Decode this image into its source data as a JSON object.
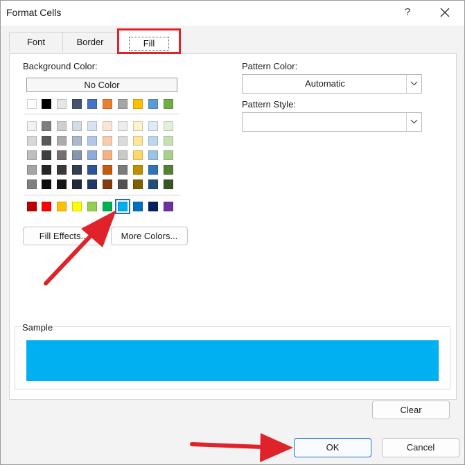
{
  "window": {
    "title": "Format Cells",
    "help_label": "?"
  },
  "tabs": [
    {
      "label": "Font"
    },
    {
      "label": "Border"
    },
    {
      "label": "Fill"
    }
  ],
  "fill": {
    "background_color_label": "Background Color:",
    "no_color_label": "No Color",
    "theme_row": [
      "#ffffff",
      "#000000",
      "#e7e6e6",
      "#44546a",
      "#4472c4",
      "#ed7d31",
      "#a5a5a5",
      "#ffc000",
      "#5b9bd5",
      "#70ad47"
    ],
    "tint_rows": [
      [
        "#f2f2f2",
        "#7f7f7f",
        "#d0cece",
        "#d6dce4",
        "#d9e2f3",
        "#fbe5d5",
        "#ededed",
        "#fff2cc",
        "#deebf6",
        "#e2efd9"
      ],
      [
        "#d8d8d8",
        "#595959",
        "#aeabab",
        "#adb9ca",
        "#b4c6e7",
        "#f7cbac",
        "#dbdbdb",
        "#fee599",
        "#bdd7ee",
        "#c5e0b3"
      ],
      [
        "#bfbfbf",
        "#3f3f3f",
        "#757070",
        "#8496b0",
        "#8eaadb",
        "#f4b183",
        "#c9c9c9",
        "#ffd965",
        "#9cc3e5",
        "#a8d08d"
      ],
      [
        "#a5a5a5",
        "#262626",
        "#3a3838",
        "#323f4f",
        "#2f5496",
        "#c55a11",
        "#7b7b7b",
        "#bf9000",
        "#2e75b5",
        "#538135"
      ],
      [
        "#7f7f7f",
        "#0c0c0c",
        "#171616",
        "#222a35",
        "#1f3864",
        "#833c0b",
        "#525252",
        "#7f6000",
        "#1e4e79",
        "#375623"
      ]
    ],
    "standard_row": [
      "#c00000",
      "#ff0000",
      "#ffc000",
      "#ffff00",
      "#92d050",
      "#00b050",
      "#00b0f0",
      "#0070c0",
      "#002060",
      "#7030a0"
    ],
    "selected_color": "#00b0f0",
    "fill_effects_label": "Fill Effects...",
    "more_colors_label": "More Colors...",
    "pattern_color_label": "Pattern Color:",
    "pattern_color_value": "Automatic",
    "pattern_style_label": "Pattern Style:",
    "pattern_style_value": "",
    "sample_label": "Sample",
    "sample_color": "#00b0f0",
    "clear_label": "Clear"
  },
  "footer": {
    "ok_label": "OK",
    "cancel_label": "Cancel"
  },
  "annotations": {
    "highlight_color": "#e0232b"
  }
}
